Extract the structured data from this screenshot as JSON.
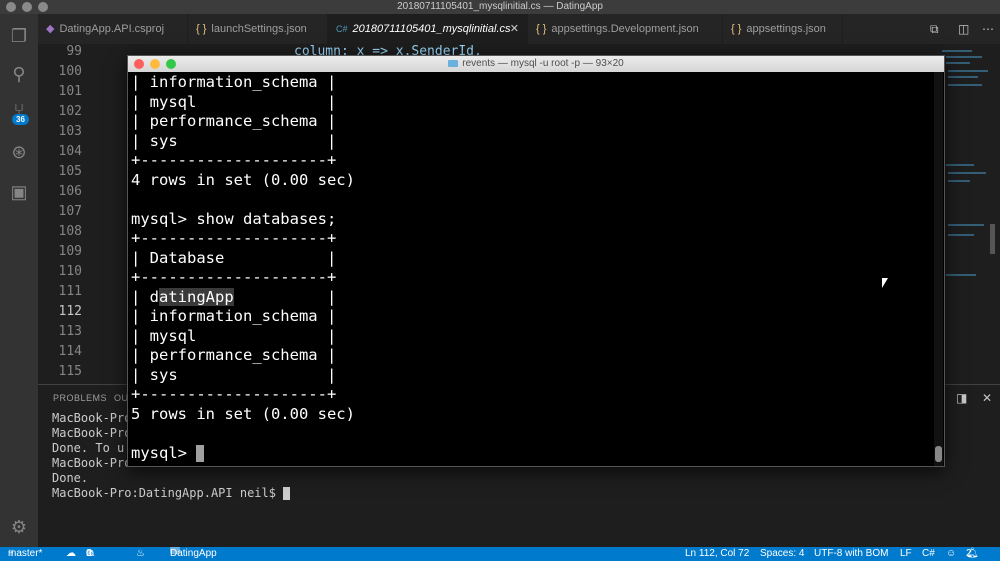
{
  "window": {
    "title": "20180711105401_mysqlinitial.cs — DatingApp"
  },
  "tabs": [
    {
      "icon": "proj",
      "label": "DatingApp.API.csproj"
    },
    {
      "icon": "json",
      "label": "launchSettings.json"
    },
    {
      "icon": "cs",
      "label": "20180711105401_mysqlinitial.cs",
      "active": true
    },
    {
      "icon": "json",
      "label": "appsettings.Development.json"
    },
    {
      "icon": "json",
      "label": "appsettings.json"
    }
  ],
  "activity": {
    "scm_badge": "36"
  },
  "editor": {
    "line_numbers": [
      "99",
      "100",
      "101",
      "102",
      "103",
      "104",
      "105",
      "106",
      "107",
      "108",
      "109",
      "110",
      "111",
      "112",
      "113",
      "114",
      "115"
    ],
    "current_line": "112",
    "visible_code": "column: x => x.SenderId,"
  },
  "panel": {
    "tab_problems": "PROBLEMS",
    "tab_output": "OU",
    "terminal_lines": [
      "MacBook-Pro",
      "MacBook-Pro",
      "Done. To u",
      "MacBook-Pro",
      "Done.",
      "MacBook-Pro:DatingApp.API neil$ "
    ]
  },
  "mac_terminal": {
    "title": "revents — mysql -u root -p — 93×20",
    "lines": [
      "| information_schema |",
      "| mysql              |",
      "| performance_schema |",
      "| sys                |",
      "+--------------------+",
      "4 rows in set (0.00 sec)",
      "",
      "mysql> show databases;",
      "+--------------------+",
      "| Database           |",
      "+--------------------+",
      "| datingApp          |",
      "| information_schema |",
      "| mysql              |",
      "| performance_schema |",
      "| sys                |",
      "+--------------------+",
      "5 rows in set (0.00 sec)",
      "",
      "mysql> "
    ]
  },
  "statusbar": {
    "branch": "master*",
    "errors": "0",
    "warnings": "0",
    "folder": "DatingApp",
    "position": "Ln 112, Col 72",
    "spaces": "Spaces: 4",
    "encoding": "UTF-8 with BOM",
    "eol": "LF",
    "language": "C#",
    "notifications": "2"
  },
  "colors": {
    "accent": "#007acc",
    "terminal_bg": "#000000",
    "editor_bg": "#1e1e1e"
  }
}
